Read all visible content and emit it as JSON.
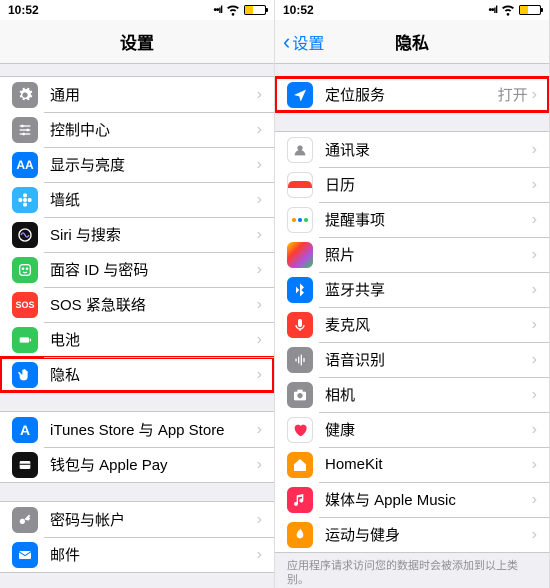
{
  "status": {
    "time": "10:52"
  },
  "left": {
    "title": "设置",
    "groups": [
      {
        "items": [
          {
            "icon": "general-icon",
            "cls": "ic-gray",
            "glyph": "gear",
            "label": "通用"
          },
          {
            "icon": "control-center-icon",
            "cls": "ic-gray",
            "glyph": "sliders",
            "label": "控制中心"
          },
          {
            "icon": "display-icon",
            "cls": "ic-blue",
            "glyph": "AA",
            "label": "显示与亮度"
          },
          {
            "icon": "wallpaper-icon",
            "cls": "ic-cyan",
            "glyph": "flower",
            "label": "墙纸"
          },
          {
            "icon": "siri-icon",
            "cls": "ic-black",
            "glyph": "siri",
            "label": "Siri 与搜索"
          },
          {
            "icon": "faceid-icon",
            "cls": "ic-green",
            "glyph": "face",
            "label": "面容 ID 与密码"
          },
          {
            "icon": "sos-icon",
            "cls": "ic-red",
            "glyph": "SOS",
            "label": "SOS 紧急联络"
          },
          {
            "icon": "battery-icon",
            "cls": "ic-green",
            "glyph": "battery",
            "label": "电池"
          },
          {
            "icon": "privacy-icon",
            "cls": "ic-blue",
            "glyph": "hand",
            "label": "隐私",
            "highlight": true
          }
        ]
      },
      {
        "items": [
          {
            "icon": "appstore-icon",
            "cls": "ic-blue",
            "glyph": "A",
            "label": "iTunes Store 与 App Store"
          },
          {
            "icon": "wallet-icon",
            "cls": "ic-black",
            "glyph": "wallet",
            "label": "钱包与 Apple Pay"
          }
        ]
      },
      {
        "items": [
          {
            "icon": "passwords-icon",
            "cls": "ic-gray",
            "glyph": "key",
            "label": "密码与帐户"
          },
          {
            "icon": "mail-icon",
            "cls": "ic-blue",
            "glyph": "mail",
            "label": "邮件"
          }
        ]
      }
    ]
  },
  "right": {
    "back": "设置",
    "title": "隐私",
    "groups": [
      {
        "items": [
          {
            "icon": "location-icon",
            "cls": "ic-blue",
            "glyph": "arrow",
            "label": "定位服务",
            "detail": "打开",
            "highlight": true
          }
        ]
      },
      {
        "items": [
          {
            "icon": "contacts-icon",
            "cls": "ic-white",
            "glyph": "contact",
            "label": "通讯录"
          },
          {
            "icon": "calendar-icon",
            "cls": "ic-cal",
            "glyph": "cal",
            "label": "日历"
          },
          {
            "icon": "reminders-icon",
            "cls": "ic-remind",
            "glyph": "dots",
            "label": "提醒事项"
          },
          {
            "icon": "photos-icon",
            "cls": "ic-photo",
            "glyph": "",
            "label": "照片"
          },
          {
            "icon": "bluetooth-icon",
            "cls": "ic-blue",
            "glyph": "bt",
            "label": "蓝牙共享"
          },
          {
            "icon": "microphone-icon",
            "cls": "ic-red",
            "glyph": "mic",
            "label": "麦克风"
          },
          {
            "icon": "speech-icon",
            "cls": "ic-gray",
            "glyph": "wave",
            "label": "语音识别"
          },
          {
            "icon": "camera-icon",
            "cls": "ic-gray",
            "glyph": "camera",
            "label": "相机"
          },
          {
            "icon": "health-icon",
            "cls": "ic-white",
            "glyph": "heart",
            "label": "健康"
          },
          {
            "icon": "homekit-icon",
            "cls": "ic-orange",
            "glyph": "home",
            "label": "HomeKit"
          },
          {
            "icon": "music-icon",
            "cls": "ic-pink",
            "glyph": "note",
            "label": "媒体与 Apple Music"
          },
          {
            "icon": "activity-icon",
            "cls": "ic-orange",
            "glyph": "flame",
            "label": "运动与健身"
          }
        ]
      }
    ],
    "footer": "应用程序请求访问您的数据时会被添加到以上类别。"
  }
}
